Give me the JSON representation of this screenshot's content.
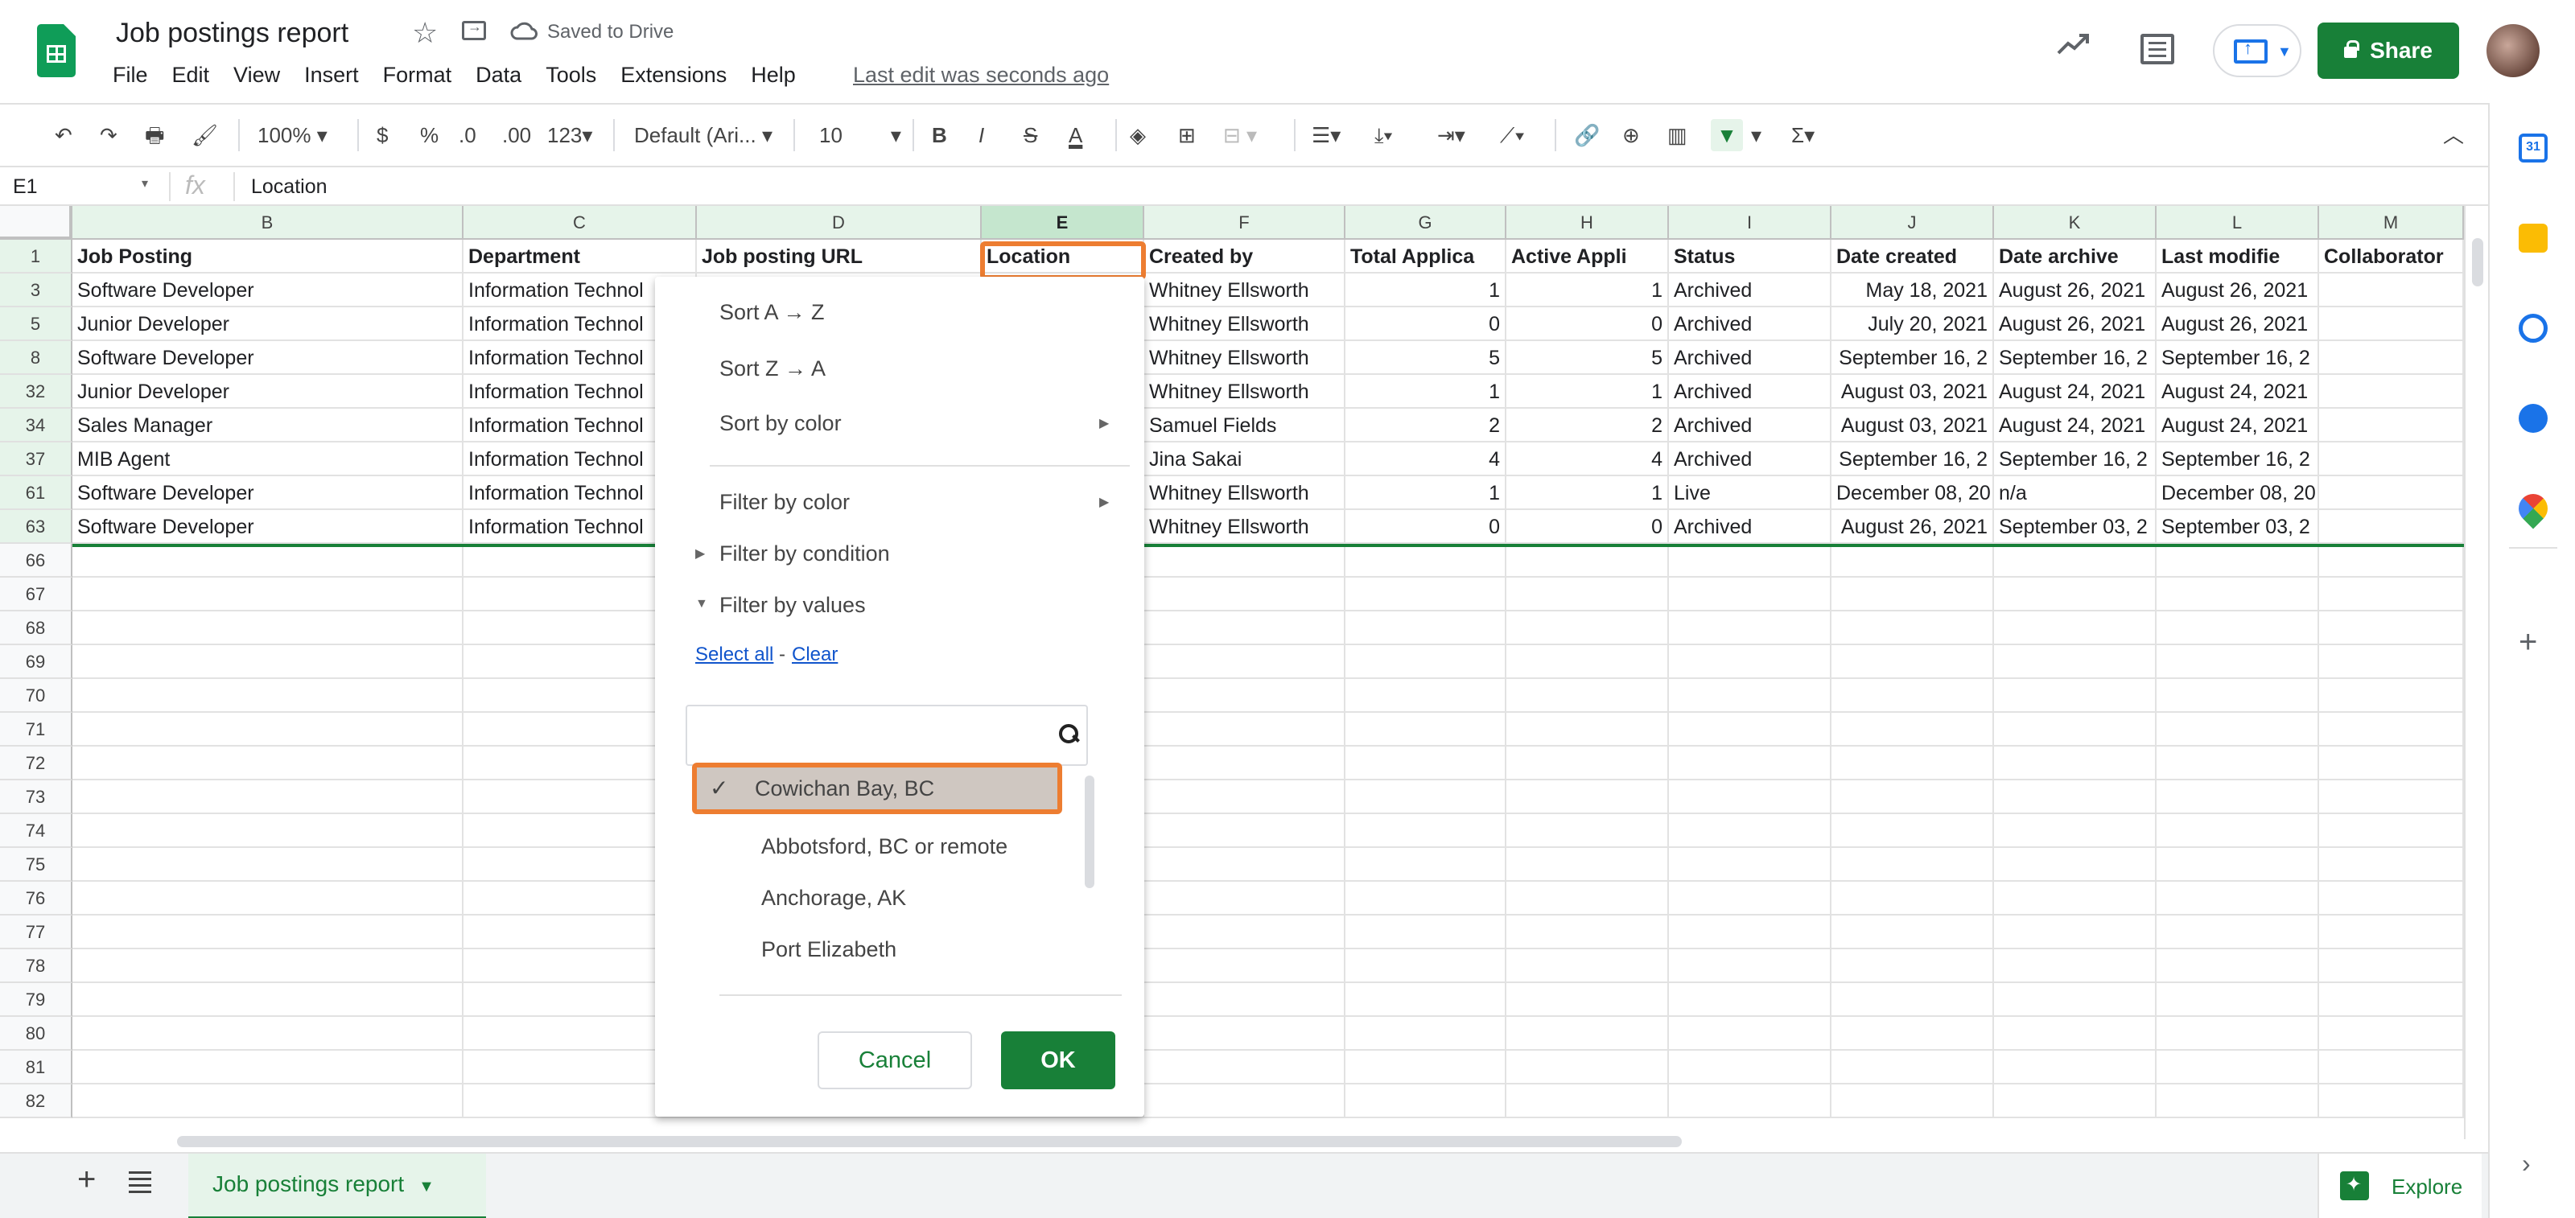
{
  "app": {
    "title": "Job postings report",
    "saved_status": "Saved to Drive",
    "last_edit": "Last edit was seconds ago",
    "share_label": "Share"
  },
  "menu": [
    "File",
    "Edit",
    "View",
    "Insert",
    "Format",
    "Data",
    "Tools",
    "Extensions",
    "Help"
  ],
  "toolbar": {
    "zoom": "100%",
    "currency": "$",
    "percent": "%",
    "dec_dec": ".0",
    "dec_inc": ".00",
    "more_formats": "123",
    "font": "Default (Ari...",
    "font_size": "10"
  },
  "formula_bar": {
    "cell_ref": "E1",
    "fx": "fx",
    "value": "Location"
  },
  "columns": [
    "B",
    "C",
    "D",
    "E",
    "F",
    "G",
    "H",
    "I",
    "J",
    "K",
    "L",
    "M"
  ],
  "headers": [
    "Job Posting",
    "Department",
    "Job posting URL",
    "Location",
    "Created by",
    "Total Applica",
    "Active Appli",
    "Status",
    "Date created",
    "Date archive",
    "Last modifie",
    "Collaborator"
  ],
  "header_row_number": "1",
  "rows": [
    {
      "n": "3",
      "job": "Software Developer",
      "dept": "Information Technol",
      "by": "Whitney Ellsworth",
      "total": "1",
      "active": "1",
      "status": "Archived",
      "created": "May 18, 2021",
      "archived": "August 26, 2021",
      "modified": "August 26, 2021"
    },
    {
      "n": "5",
      "job": "Junior Developer",
      "dept": "Information Technol",
      "by": "Whitney Ellsworth",
      "total": "0",
      "active": "0",
      "status": "Archived",
      "created": "July 20, 2021",
      "archived": "August 26, 2021",
      "modified": "August 26, 2021"
    },
    {
      "n": "8",
      "job": "Software Developer",
      "dept": "Information Technol",
      "by": "Whitney Ellsworth",
      "total": "5",
      "active": "5",
      "status": "Archived",
      "created": "September 16, 2",
      "archived": "September 16, 2",
      "modified": "September 16, 2"
    },
    {
      "n": "32",
      "job": "Junior Developer",
      "dept": "Information Technol",
      "by": "Whitney Ellsworth",
      "total": "1",
      "active": "1",
      "status": "Archived",
      "created": "August 03, 2021",
      "archived": "August 24, 2021",
      "modified": "August 24, 2021"
    },
    {
      "n": "34",
      "job": "Sales Manager",
      "dept": "Information Technol",
      "by": "Samuel Fields",
      "total": "2",
      "active": "2",
      "status": "Archived",
      "created": "August 03, 2021",
      "archived": "August 24, 2021",
      "modified": "August 24, 2021"
    },
    {
      "n": "37",
      "job": "MIB Agent",
      "dept": "Information Technol",
      "by": "Jina Sakai",
      "total": "4",
      "active": "4",
      "status": "Archived",
      "created": "September 16, 2",
      "archived": "September 16, 2",
      "modified": "September 16, 2"
    },
    {
      "n": "61",
      "job": "Software Developer",
      "dept": "Information Technol",
      "by": "Whitney Ellsworth",
      "total": "1",
      "active": "1",
      "status": "Live",
      "created": "December 08, 20",
      "archived": "n/a",
      "modified": "December 08, 20"
    },
    {
      "n": "63",
      "job": "Software Developer",
      "dept": "Information Technol",
      "by": "Whitney Ellsworth",
      "total": "0",
      "active": "0",
      "status": "Archived",
      "created": "August 26, 2021",
      "archived": "September 03, 2",
      "modified": "September 03, 2"
    }
  ],
  "empty_rows": [
    "66",
    "67",
    "68",
    "69",
    "70",
    "71",
    "72",
    "73",
    "74",
    "75",
    "76",
    "77",
    "78",
    "79",
    "80",
    "81",
    "82"
  ],
  "filter_menu": {
    "sort_az": "Sort A → Z",
    "sort_za": "Sort Z → A",
    "sort_color": "Sort by color",
    "filter_color": "Filter by color",
    "filter_condition": "Filter by condition",
    "filter_values": "Filter by values",
    "select_all": "Select all",
    "separator": "-",
    "clear": "Clear",
    "search_value": "",
    "values": [
      {
        "label": "Cowichan Bay, BC",
        "checked": true
      },
      {
        "label": "Abbotsford, BC or remote",
        "checked": false
      },
      {
        "label": "Anchorage, AK",
        "checked": false
      },
      {
        "label": "Port Elizabeth",
        "checked": false
      }
    ],
    "cancel": "Cancel",
    "ok": "OK"
  },
  "sheet_tab": "Job postings report",
  "explore": "Explore",
  "colors": {
    "accent": "#188038",
    "highlight": "#ed7d31",
    "header_bg": "#e6f4ea"
  }
}
